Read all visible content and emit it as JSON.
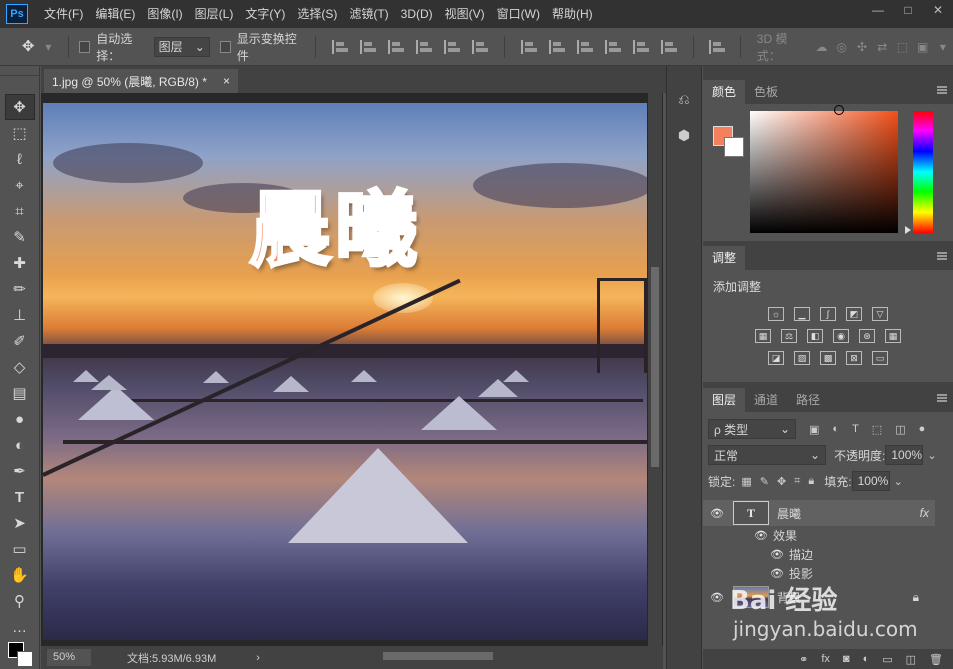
{
  "app": {
    "logo": "Ps"
  },
  "menu": [
    "文件(F)",
    "编辑(E)",
    "图像(I)",
    "图层(L)",
    "文字(Y)",
    "选择(S)",
    "滤镜(T)",
    "3D(D)",
    "视图(V)",
    "窗口(W)",
    "帮助(H)"
  ],
  "options": {
    "auto_select_label": "自动选择：",
    "auto_select_value": "图层",
    "show_transform_label": "显示变换控件",
    "mode_3d_label": "3D 模式："
  },
  "document": {
    "tab_title": "1.jpg @ 50% (晨曦, RGB/8) *",
    "canvas_text": "晨曦",
    "zoom": "50%",
    "doc_info": "文档:5.93M/6.93M"
  },
  "panels": {
    "color": {
      "tabs": [
        "颜色",
        "色板"
      ],
      "foreground": "#f4805e"
    },
    "adjustments": {
      "tab": "调整",
      "title": "添加调整"
    },
    "layers": {
      "tabs": [
        "图层",
        "通道",
        "路径"
      ],
      "filter_kind": "ρ 类型",
      "blend_mode": "正常",
      "opacity_label": "不透明度:",
      "opacity_value": "100%",
      "lock_label": "锁定:",
      "fill_label": "填充:",
      "fill_value": "100%",
      "items": [
        {
          "name": "晨曦",
          "thumb": "T",
          "fx": "fx"
        },
        {
          "name": "效果"
        },
        {
          "name": "描边"
        },
        {
          "name": "投影"
        },
        {
          "name": "背景"
        }
      ]
    }
  },
  "watermark": {
    "main": "Bai 经验",
    "sub": "jingyan.baidu.com"
  },
  "colors": {
    "accent": "#f4805e",
    "stroke": "#ffffff"
  }
}
